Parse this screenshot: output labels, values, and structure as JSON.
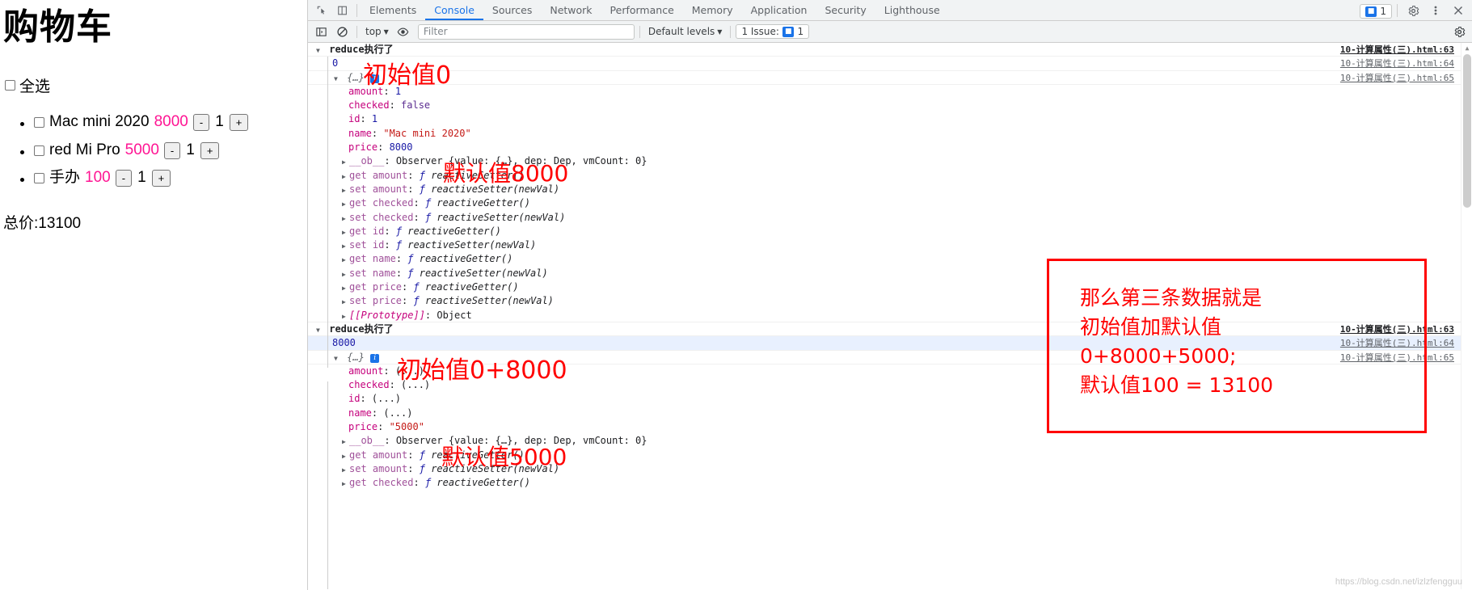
{
  "page": {
    "title": "购物车",
    "select_all_label": "全选",
    "items": [
      {
        "name": "Mac mini 2020",
        "price": "8000",
        "qty": "1",
        "minus": "-",
        "plus": "+"
      },
      {
        "name": "red Mi Pro",
        "price": "5000",
        "qty": "1",
        "minus": "-",
        "plus": "+"
      },
      {
        "name": "手办",
        "price": "100",
        "qty": "1",
        "minus": "-",
        "plus": "+"
      }
    ],
    "total_label": "总价:13100",
    "price_color": "#ff1493"
  },
  "devtools": {
    "tabs": [
      {
        "label": "Elements",
        "active": false
      },
      {
        "label": "Console",
        "active": true
      },
      {
        "label": "Sources",
        "active": false
      },
      {
        "label": "Network",
        "active": false
      },
      {
        "label": "Performance",
        "active": false
      },
      {
        "label": "Memory",
        "active": false
      },
      {
        "label": "Application",
        "active": false
      },
      {
        "label": "Security",
        "active": false
      },
      {
        "label": "Lighthouse",
        "active": false
      }
    ],
    "inspect_icon": "inspect-element-icon",
    "device_icon": "device-toolbar-icon",
    "issues_chip": {
      "text": "1",
      "label_left": "1 Issue:"
    },
    "settings_icon": "gear-icon",
    "more_icon": "kebab-menu-icon",
    "close_icon": "close-icon",
    "accent": "#1a73e8",
    "console_toolbar": {
      "sidebar_toggle_icon": "console-sidebar-icon",
      "clear_icon": "clear-console-icon",
      "context_selector": "top",
      "eye_icon": "live-expression-icon",
      "filter_placeholder": "Filter",
      "filter_value": "",
      "levels_selector": "Default levels",
      "issues_button": "1 Issue:",
      "issues_count": "1",
      "gear_icon": "gear-icon"
    },
    "console": {
      "group1": {
        "title": "reduce执行了",
        "src": "10-计算属性(三).html:63",
        "value_line": {
          "value": "0",
          "src": "10-计算属性(三).html:64"
        },
        "object_line": {
          "brace": "{…}",
          "src": "10-计算属性(三).html:65"
        },
        "props": [
          {
            "key": "amount",
            "sep": ": ",
            "value": "1",
            "vtype": "num"
          },
          {
            "key": "checked",
            "sep": ": ",
            "value": "false",
            "vtype": "bool"
          },
          {
            "key": "id",
            "sep": ": ",
            "value": "1",
            "vtype": "num"
          },
          {
            "key": "name",
            "sep": ": ",
            "value": "\"Mac mini 2020\"",
            "vtype": "str"
          },
          {
            "key": "price",
            "sep": ": ",
            "value": "8000",
            "vtype": "num"
          }
        ],
        "observer": {
          "key": "__ob__",
          "value": "Observer {value: {…}, dep: Dep, vmCount: 0}"
        },
        "accessors": [
          {
            "prefix": "get ",
            "key": "amount",
            "fn": "reactiveGetter()"
          },
          {
            "prefix": "set ",
            "key": "amount",
            "fn": "reactiveSetter(newVal)"
          },
          {
            "prefix": "get ",
            "key": "checked",
            "fn": "reactiveGetter()"
          },
          {
            "prefix": "set ",
            "key": "checked",
            "fn": "reactiveSetter(newVal)"
          },
          {
            "prefix": "get ",
            "key": "id",
            "fn": "reactiveGetter()"
          },
          {
            "prefix": "set ",
            "key": "id",
            "fn": "reactiveSetter(newVal)"
          },
          {
            "prefix": "get ",
            "key": "name",
            "fn": "reactiveGetter()"
          },
          {
            "prefix": "set ",
            "key": "name",
            "fn": "reactiveSetter(newVal)"
          },
          {
            "prefix": "get ",
            "key": "price",
            "fn": "reactiveGetter()"
          },
          {
            "prefix": "set ",
            "key": "price",
            "fn": "reactiveSetter(newVal)"
          }
        ],
        "prototype": {
          "key": "[[Prototype]]",
          "value": "Object"
        }
      },
      "group2": {
        "title": "reduce执行了",
        "src": "10-计算属性(三).html:63",
        "value_line": {
          "value": "8000",
          "src": "10-计算属性(三).html:64"
        },
        "object_line": {
          "brace": "{…}",
          "src": "10-计算属性(三).html:65"
        },
        "props": [
          {
            "key": "amount",
            "sep": ": ",
            "value": "(...)",
            "vtype": "plain"
          },
          {
            "key": "checked",
            "sep": ": ",
            "value": "(...)",
            "vtype": "plain"
          },
          {
            "key": "id",
            "sep": ": ",
            "value": "(...)",
            "vtype": "plain"
          },
          {
            "key": "name",
            "sep": ": ",
            "value": "(...)",
            "vtype": "plain"
          },
          {
            "key": "price",
            "sep": ": ",
            "value": "\"5000\"",
            "vtype": "str"
          }
        ],
        "observer": {
          "key": "__ob__",
          "value": "Observer {value: {…}, dep: Dep, vmCount: 0}"
        },
        "accessors": [
          {
            "prefix": "get ",
            "key": "amount",
            "fn": "reactiveGetter()"
          },
          {
            "prefix": "set ",
            "key": "amount",
            "fn": "reactiveSetter(newVal)"
          },
          {
            "prefix": "get ",
            "key": "checked",
            "fn": "reactiveGetter()"
          }
        ]
      }
    },
    "annotations": {
      "a1": "初始值0",
      "a2": "默认值8000",
      "a3": "初始值0+8000",
      "a4": "默认值5000",
      "box": [
        "那么第三条数据就是",
        "初始值加默认值",
        "0+8000+5000;",
        "默认值100 = 13100"
      ],
      "color": "#ff0000"
    },
    "watermark": "https://blog.csdn.net/izlzfengguu"
  }
}
